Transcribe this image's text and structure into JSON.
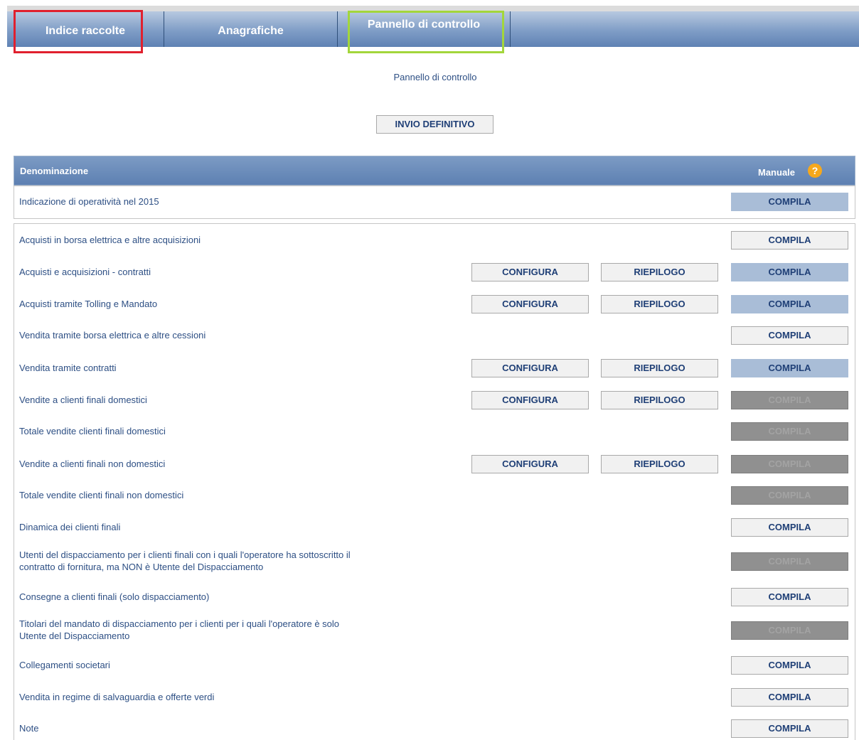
{
  "nav": {
    "tabs": [
      {
        "label": "Indice raccolte"
      },
      {
        "label": "Anagrafiche"
      },
      {
        "label": "Pannello di controllo"
      }
    ]
  },
  "page_title": "Pannello di controllo",
  "invio_button": "INVIO DEFINITIVO",
  "table": {
    "col_name": "Denominazione",
    "col_manual": "Manuale",
    "help_symbol": "?"
  },
  "buttons": {
    "configura": "CONFIGURA",
    "riepilogo": "RIEPILOGO",
    "compila": "COMPILA"
  },
  "first_row": {
    "label": "Indicazione di operatività nel 2015",
    "compila_state": "blue"
  },
  "rows": [
    {
      "label": "Acquisti in borsa elettrica e altre acquisizioni",
      "configura": false,
      "compila_state": "normal"
    },
    {
      "label": "Acquisti e acquisizioni - contratti",
      "configura": true,
      "compila_state": "blue"
    },
    {
      "label": "Acquisti tramite Tolling e Mandato",
      "configura": true,
      "compila_state": "blue"
    },
    {
      "label": "Vendita tramite borsa elettrica e altre cessioni",
      "configura": false,
      "compila_state": "normal"
    },
    {
      "label": "Vendita tramite contratti",
      "configura": true,
      "compila_state": "blue"
    },
    {
      "label": "Vendite a clienti finali domestici",
      "configura": true,
      "compila_state": "disabled"
    },
    {
      "label": "Totale vendite clienti finali domestici",
      "configura": false,
      "compila_state": "disabled"
    },
    {
      "label": "Vendite a clienti finali non domestici",
      "configura": true,
      "compila_state": "disabled"
    },
    {
      "label": "Totale vendite clienti finali non domestici",
      "configura": false,
      "compila_state": "disabled"
    },
    {
      "label": "Dinamica dei clienti finali",
      "configura": false,
      "compila_state": "normal"
    },
    {
      "label_lines": [
        "Utenti del dispacciamento per i clienti finali con i quali l'operatore ha sottoscritto il",
        "contratto di fornitura, ma NON è Utente del Dispacciamento"
      ],
      "configura": false,
      "compila_state": "disabled"
    },
    {
      "label": "Consegne a clienti finali (solo dispacciamento)",
      "configura": false,
      "compila_state": "normal"
    },
    {
      "label_lines": [
        "Titolari del mandato di dispacciamento per i clienti per i quali l'operatore è solo",
        "Utente del Dispacciamento"
      ],
      "configura": false,
      "compila_state": "disabled"
    },
    {
      "label": "Collegamenti societari",
      "configura": false,
      "compila_state": "normal"
    },
    {
      "label": "Vendita in regime di salvaguardia e offerte verdi",
      "configura": false,
      "compila_state": "normal"
    },
    {
      "label": "Note",
      "configura": false,
      "compila_state": "normal"
    }
  ],
  "colors": {
    "accent": "#5f82b4",
    "text": "#2d4f84",
    "highlight_red": "#e0202e",
    "highlight_green": "#a3d63b"
  }
}
